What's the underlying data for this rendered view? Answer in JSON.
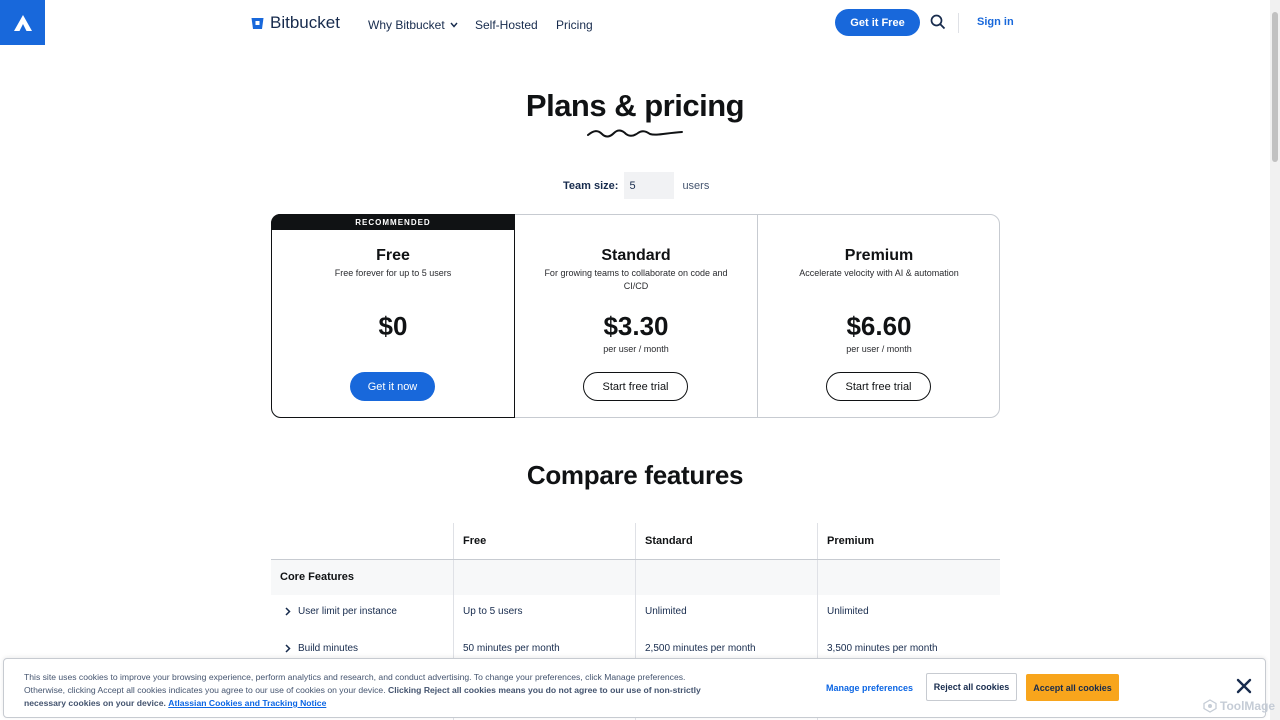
{
  "nav": {
    "brand": "Bitbucket",
    "links": [
      "Why Bitbucket",
      "Self-Hosted",
      "Pricing"
    ],
    "cta": "Get it Free",
    "signin": "Sign in"
  },
  "hero": {
    "title": "Plans & pricing",
    "team_label": "Team size:",
    "team_value": "5",
    "team_unit": "users"
  },
  "plans": [
    {
      "badge": "RECOMMENDED",
      "name": "Free",
      "desc": "Free forever for up to 5 users",
      "price": "$0",
      "per": "",
      "button": "Get it now"
    },
    {
      "name": "Standard",
      "desc": "For growing teams to collaborate on code and CI/CD",
      "price": "$3.30",
      "per": "per user / month",
      "button": "Start free trial"
    },
    {
      "name": "Premium",
      "desc": "Accelerate velocity with AI & automation",
      "price": "$6.60",
      "per": "per user / month",
      "button": "Start free trial"
    }
  ],
  "compare": {
    "title": "Compare features",
    "columns": [
      "Free",
      "Standard",
      "Premium"
    ],
    "section": "Core Features",
    "rows": [
      {
        "label": "User limit per instance",
        "values": [
          "Up to 5 users",
          "Unlimited",
          "Unlimited"
        ]
      },
      {
        "label": "Build minutes",
        "values": [
          "50 minutes per month",
          "2,500 minutes per month",
          "3,500 minutes per month"
        ]
      }
    ]
  },
  "cookie": {
    "text_plain": "This site uses cookies to improve your browsing experience, perform analytics and research, and conduct advertising. To change your preferences, click Manage preferences. Otherwise, clicking Accept all cookies indicates you agree to our use of cookies on your device.",
    "text_bold": "Clicking Reject all cookies means you do not agree to our use of non-strictly necessary cookies on your device.",
    "link": "Atlassian Cookies and Tracking Notice",
    "manage": "Manage preferences",
    "reject": "Reject all cookies",
    "accept": "Accept all cookies"
  },
  "watermark": "ToolMage",
  "colors": {
    "brand_blue": "#1868db",
    "accept_yellow": "#f8a51c",
    "ink": "#101214"
  }
}
